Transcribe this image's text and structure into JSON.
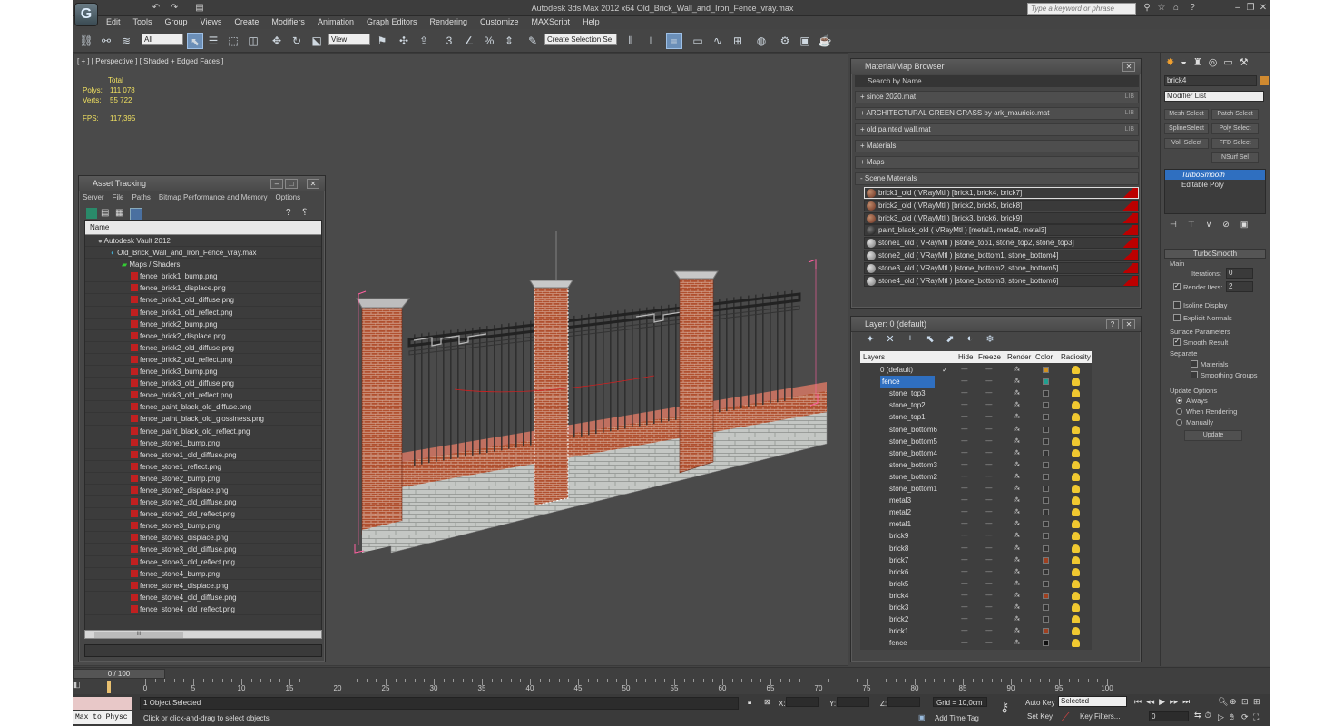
{
  "app": {
    "title": "Autodesk 3ds Max  2012 x64     Old_Brick_Wall_and_Iron_Fence_vray.max",
    "logo": "G",
    "search_placeholder": "Type a keyword or phrase"
  },
  "menu": [
    "Edit",
    "Tools",
    "Group",
    "Views",
    "Create",
    "Modifiers",
    "Animation",
    "Graph Editors",
    "Rendering",
    "Customize",
    "MAXScript",
    "Help"
  ],
  "toolbar": {
    "filter": "All",
    "ref_coord": "View",
    "named_sel": "Create Selection Se"
  },
  "viewport": {
    "label": "[ + ] [ Perspective ] [ Shaded + Edged Faces ]",
    "stats_header": "Total",
    "polys_label": "Polys:",
    "polys": "111 078",
    "verts_label": "Verts:",
    "verts": "55 722",
    "fps_label": "FPS:",
    "fps": "117,395"
  },
  "asset_tracking": {
    "title": "Asset Tracking",
    "menu": [
      "Server",
      "File",
      "Paths",
      "Bitmap Performance and Memory",
      "Options"
    ],
    "column": "Name",
    "vault": "Autodesk Vault 2012",
    "file": "Old_Brick_Wall_and_Iron_Fence_vray.max",
    "group": "Maps / Shaders",
    "files": [
      "fence_brick1_bump.png",
      "fence_brick1_displace.png",
      "fence_brick1_old_diffuse.png",
      "fence_brick1_old_reflect.png",
      "fence_brick2_bump.png",
      "fence_brick2_displace.png",
      "fence_brick2_old_diffuse.png",
      "fence_brick2_old_reflect.png",
      "fence_brick3_bump.png",
      "fence_brick3_old_diffuse.png",
      "fence_brick3_old_reflect.png",
      "fence_paint_black_old_diffuse.png",
      "fence_paint_black_old_glossiness.png",
      "fence_paint_black_old_reflect.png",
      "fence_stone1_bump.png",
      "fence_stone1_old_diffuse.png",
      "fence_stone1_reflect.png",
      "fence_stone2_bump.png",
      "fence_stone2_displace.png",
      "fence_stone2_old_diffuse.png",
      "fence_stone2_old_reflect.png",
      "fence_stone3_bump.png",
      "fence_stone3_displace.png",
      "fence_stone3_old_diffuse.png",
      "fence_stone3_old_reflect.png",
      "fence_stone4_bump.png",
      "fence_stone4_displace.png",
      "fence_stone4_old_diffuse.png",
      "fence_stone4_old_reflect.png"
    ],
    "scroll_grip": "III"
  },
  "material_browser": {
    "title": "Material/Map Browser",
    "search": "Search by Name ...",
    "lib_label": "LIB",
    "groups": [
      "+ since 2020.mat",
      "+ ARCHITECTURAL GREEN GRASS by ark_mauricio.mat",
      "+ old painted wall.mat",
      "+ Materials",
      "+ Maps",
      "- Scene Materials"
    ],
    "materials": [
      "brick1_old  ( VRayMtl )  [brick1, brick4, brick7]",
      "brick2_old  ( VRayMtl )  [brick2, brick5, brick8]",
      "brick3_old  ( VRayMtl )  [brick3, brick6, brick9]",
      "paint_black_old  ( VRayMtl )  [metal1, metal2, metal3]",
      "stone1_old  ( VRayMtl )  [stone_top1, stone_top2, stone_top3]",
      "stone2_old  ( VRayMtl )  [stone_bottom1, stone_bottom4]",
      "stone3_old  ( VRayMtl )  [stone_bottom2, stone_bottom5]",
      "stone4_old  ( VRayMtl )  [stone_bottom3, stone_bottom6]"
    ]
  },
  "layer_window": {
    "title": "Layer: 0 (default)",
    "columns": [
      "Layers",
      "Hide",
      "Freeze",
      "Render",
      "Color",
      "Radiosity"
    ],
    "dots": "-----",
    "layers": [
      {
        "name": "0 (default)",
        "color": "#d09020"
      },
      {
        "name": "fence",
        "color": "#20a090"
      },
      {
        "name": "stone_top3",
        "color": "#333333"
      },
      {
        "name": "stone_top2",
        "color": "#333333"
      },
      {
        "name": "stone_top1",
        "color": "#333333"
      },
      {
        "name": "stone_bottom6",
        "color": "#333333"
      },
      {
        "name": "stone_bottom5",
        "color": "#333333"
      },
      {
        "name": "stone_bottom4",
        "color": "#333333"
      },
      {
        "name": "stone_bottom3",
        "color": "#333333"
      },
      {
        "name": "stone_bottom2",
        "color": "#333333"
      },
      {
        "name": "stone_bottom1",
        "color": "#333333"
      },
      {
        "name": "metal3",
        "color": "#333333"
      },
      {
        "name": "metal2",
        "color": "#333333"
      },
      {
        "name": "metal1",
        "color": "#333333"
      },
      {
        "name": "brick9",
        "color": "#333333"
      },
      {
        "name": "brick8",
        "color": "#333333"
      },
      {
        "name": "brick7",
        "color": "#a04020"
      },
      {
        "name": "brick6",
        "color": "#333333"
      },
      {
        "name": "brick5",
        "color": "#333333"
      },
      {
        "name": "brick4",
        "color": "#a04020"
      },
      {
        "name": "brick3",
        "color": "#333333"
      },
      {
        "name": "brick2",
        "color": "#333333"
      },
      {
        "name": "brick1",
        "color": "#a04020"
      },
      {
        "name": "fence",
        "color": "#111111"
      }
    ]
  },
  "command_panel": {
    "object_name": "brick4",
    "modifier_list": "Modifier List",
    "buttons": [
      "Mesh Select",
      "Patch Select",
      "SplineSelect",
      "Poly Select",
      "Vol. Select",
      "FFD Select",
      "NSurf Sel"
    ],
    "stack": [
      "TurboSmooth",
      "Editable Poly"
    ],
    "rollout": "TurboSmooth",
    "main": "Main",
    "iterations_label": "Iterations:",
    "iterations": "0",
    "render_iters_label": "Render Iters:",
    "render_iters": "2",
    "isoline": "Isoline Display",
    "explicit": "Explicit Normals",
    "surface_params": "Surface Parameters",
    "smooth_result": "Smooth Result",
    "separate": "Separate",
    "materials": "Materials",
    "smoothing_groups": "Smoothing Groups",
    "update_options": "Update Options",
    "always": "Always",
    "when_rendering": "When Rendering",
    "manually": "Manually",
    "update": "Update"
  },
  "timeline": {
    "frame": "0 / 100",
    "ticks": [
      "0",
      "5",
      "10",
      "15",
      "20",
      "25",
      "30",
      "35",
      "40",
      "45",
      "50",
      "55",
      "60",
      "65",
      "70",
      "75",
      "80",
      "85",
      "90",
      "95",
      "100"
    ]
  },
  "status": {
    "maxphys": "Max to Physc",
    "selected": "1 Object Selected",
    "prompt": "Click or click-and-drag to select objects",
    "x": "X:",
    "y": "Y:",
    "z": "Z:",
    "grid": "Grid = 10,0cm",
    "add_time_tag": "Add Time Tag",
    "auto_key": "Auto Key",
    "set_key": "Set Key",
    "key_mode": "Selected",
    "key_filters": "Key Filters...",
    "current_frame": "0"
  }
}
